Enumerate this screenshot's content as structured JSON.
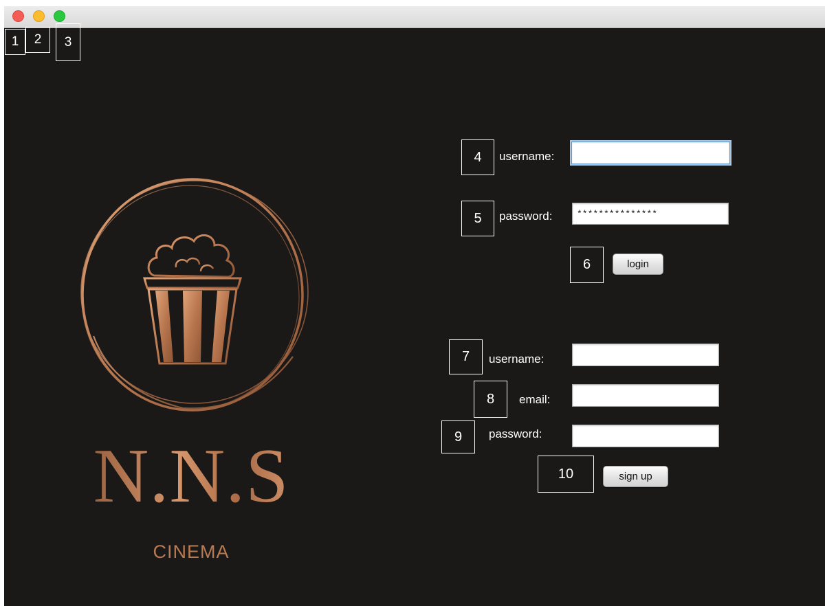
{
  "window": {
    "controls": {
      "close_icon": "close-dot-icon",
      "minimize_icon": "minimize-dot-icon",
      "maximize_icon": "maximize-dot-icon"
    }
  },
  "markers": [
    "1",
    "2",
    "3",
    "4",
    "5",
    "6",
    "7",
    "8",
    "9",
    "10"
  ],
  "brand": {
    "title": "N.N.S",
    "subtitle": "CINEMA",
    "logo_icon": "popcorn-icon",
    "accent_color": "#c98a5f"
  },
  "login": {
    "username_label": "username:",
    "username_value": "",
    "password_label": "password:",
    "password_value": "***************",
    "button_label": "login"
  },
  "signup": {
    "username_label": "username:",
    "username_value": "",
    "email_label": "email:",
    "email_value": "",
    "password_label": "password:",
    "password_value": "",
    "button_label": "sign up"
  }
}
